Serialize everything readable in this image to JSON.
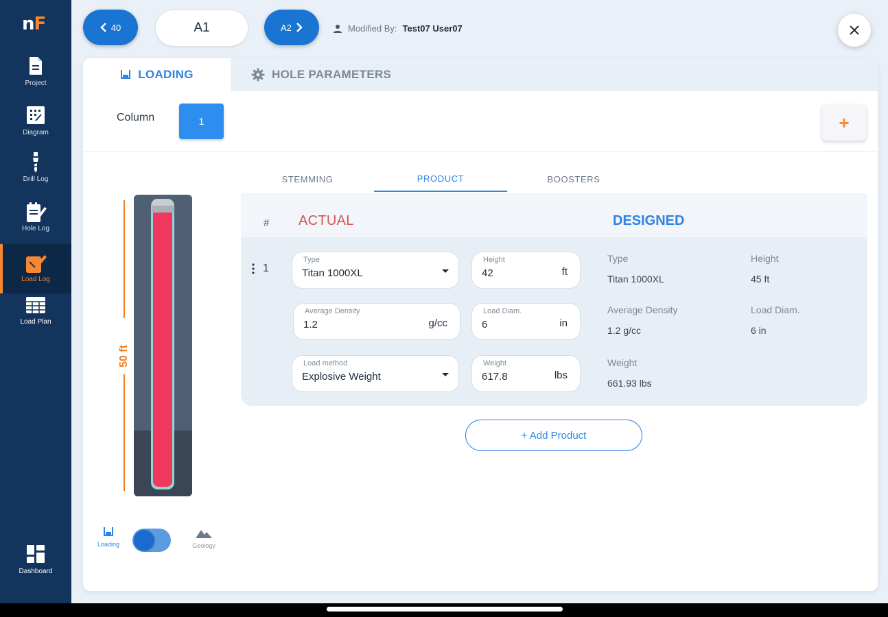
{
  "app": {
    "logo_n": "n",
    "logo_f": "F"
  },
  "sidebar": {
    "items": [
      {
        "label": "Project",
        "icon": "document-icon"
      },
      {
        "label": "Diagram",
        "icon": "diagram-icon"
      },
      {
        "label": "Drill Log",
        "icon": "drill-icon"
      },
      {
        "label": "Hole Log",
        "icon": "hole-log-icon"
      },
      {
        "label": "Load Log",
        "icon": "load-log-icon",
        "active": true
      },
      {
        "label": "Load Plan",
        "icon": "grid-icon"
      }
    ],
    "dashboard": {
      "label": "Dashboard",
      "icon": "dashboard-icon"
    }
  },
  "header": {
    "prev_label": "40",
    "hole_value": "A1",
    "next_label": "A2",
    "modified_prefix": "Modified By:",
    "modified_user": "Test07 User07"
  },
  "tabs": [
    {
      "label": "LOADING",
      "icon": "bucket-icon"
    },
    {
      "label": "HOLE PARAMETERS",
      "icon": "gear-icon"
    }
  ],
  "column": {
    "label": "Column",
    "selected": "1"
  },
  "hole_visual": {
    "depth_label": "50 ft"
  },
  "toggle": {
    "left_label": "Loading",
    "right_label": "Geology"
  },
  "subtabs": [
    "STEMMING",
    "PRODUCT",
    "BOOSTERS"
  ],
  "table": {
    "hash": "#",
    "actual_title": "ACTUAL",
    "designed_title": "DESIGNED"
  },
  "row": {
    "index": "1",
    "type": {
      "label": "Type",
      "value": "Titan 1000XL"
    },
    "height": {
      "label": "Height",
      "value": "42",
      "unit": "ft"
    },
    "density": {
      "label": "Average Density",
      "value": "1.2",
      "unit": "g/cc"
    },
    "diameter": {
      "label": "Load Diam.",
      "value": "6",
      "unit": "in"
    },
    "method": {
      "label": "Load method",
      "value": "Explosive Weight"
    },
    "weight": {
      "label": "Weight",
      "value": "617.8",
      "unit": "lbs"
    }
  },
  "designed": {
    "type": {
      "label": "Type",
      "value": "Titan 1000XL"
    },
    "height": {
      "label": "Height",
      "value": "45 ft"
    },
    "density": {
      "label": "Average Density",
      "value": "1.2 g/cc"
    },
    "diameter": {
      "label": "Load Diam.",
      "value": "6 in"
    },
    "weight": {
      "label": "Weight",
      "value": "661.93 lbs"
    }
  },
  "add_product": "+ Add Product",
  "colors": {
    "primary": "#2f83e3",
    "accent": "#f7882f",
    "sidebar": "#13345c",
    "explosive": "#f0375e",
    "actual": "#d9534f"
  }
}
